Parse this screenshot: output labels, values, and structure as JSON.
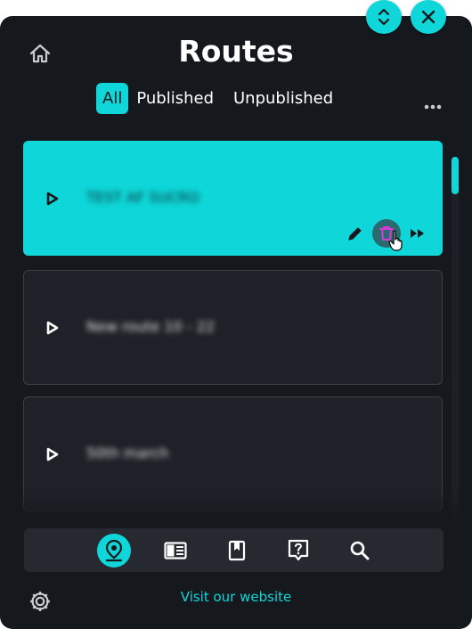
{
  "header": {
    "title": "Routes"
  },
  "tabs": [
    {
      "label": "All",
      "active": true
    },
    {
      "label": "Published",
      "active": false
    },
    {
      "label": "Unpublished",
      "active": false
    }
  ],
  "routes": [
    {
      "name": "TEST AF SUCRO",
      "selected": true
    },
    {
      "name": "New route 10 - 22",
      "selected": false
    },
    {
      "name": "50th march",
      "selected": false
    }
  ],
  "footer": {
    "website_label": "Visit our website"
  },
  "colors": {
    "accent": "#0fd7d9",
    "panel": "#15181d",
    "card": "#1f2128",
    "delete_icon": "#d63bd6"
  },
  "icons": {
    "top": [
      "expand-collapse-icon",
      "close-icon"
    ],
    "header": [
      "home-icon",
      "more-icon"
    ],
    "card": [
      "play-icon",
      "edit-icon",
      "delete-icon",
      "fast-forward-icon"
    ],
    "nav": [
      "map-pin-icon",
      "list-icon",
      "bookmark-icon",
      "help-icon",
      "search-icon"
    ],
    "footer": [
      "settings-icon"
    ]
  }
}
